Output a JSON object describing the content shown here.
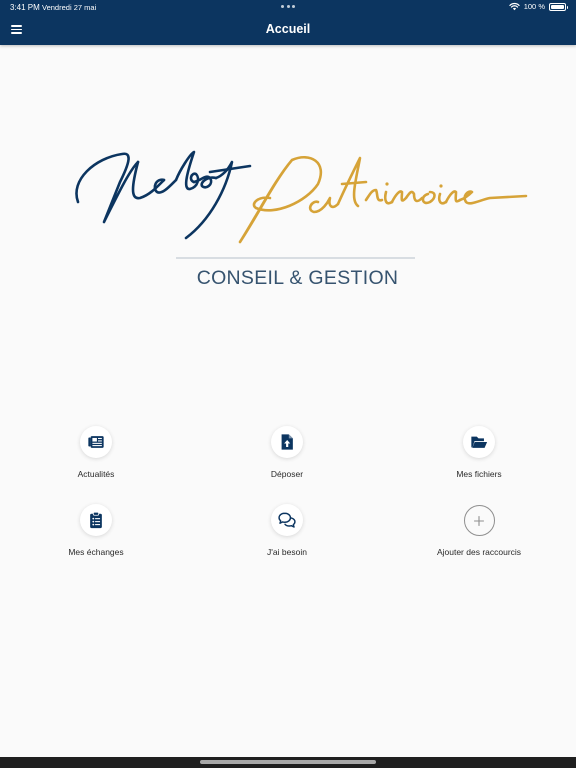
{
  "status_bar": {
    "time": "3:41 PM",
    "date": "Vendredi 27 mai",
    "battery": "100 %",
    "battery_level": 1.0
  },
  "header": {
    "title": "Accueil",
    "menu_icon": "hamburger-menu-icon",
    "background_color": "#0c3560"
  },
  "logo": {
    "wordmark_part1": "Nebot",
    "wordmark_part2": "Patrimoine",
    "tagline": "CONSEIL & GESTION",
    "primary_color": "#0c3560",
    "accent_color": "#d6a338"
  },
  "shortcuts": [
    {
      "label": "Actualités",
      "icon": "newspaper-icon"
    },
    {
      "label": "Déposer",
      "icon": "file-upload-icon"
    },
    {
      "label": "Mes fichiers",
      "icon": "folder-open-icon"
    },
    {
      "label": "Mes échanges",
      "icon": "clipboard-list-icon"
    },
    {
      "label": "J'ai besoin",
      "icon": "chat-bubbles-icon"
    },
    {
      "label": "Ajouter des raccourcis",
      "icon": "plus-icon"
    }
  ]
}
